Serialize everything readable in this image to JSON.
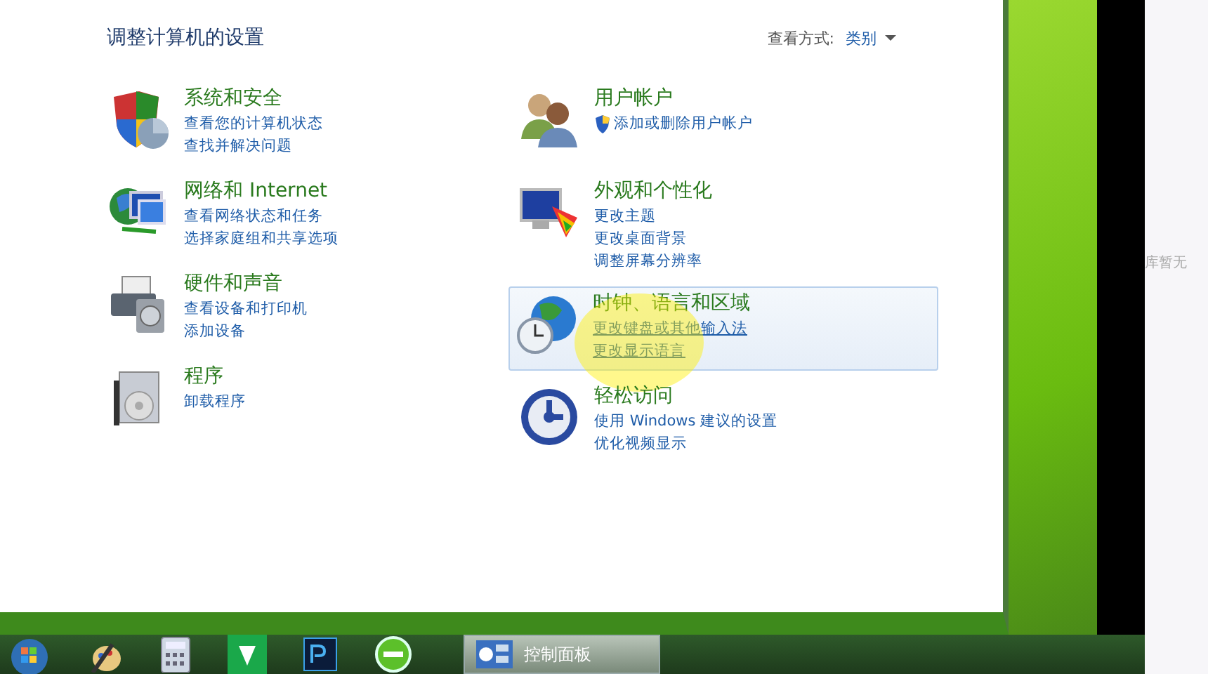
{
  "window": {
    "title": "调整计算机的设置",
    "view_by": {
      "label": "查看方式:",
      "value": "类别"
    }
  },
  "columns": [
    [
      {
        "kind": "security",
        "title": "系统和安全",
        "hovered": false,
        "links": [
          {
            "text": "查看您的计算机状态",
            "shield": false
          },
          {
            "text": "查找并解决问题",
            "shield": false
          }
        ]
      },
      {
        "kind": "network",
        "title": "网络和 Internet",
        "hovered": false,
        "links": [
          {
            "text": "查看网络状态和任务",
            "shield": false
          },
          {
            "text": "选择家庭组和共享选项",
            "shield": false
          }
        ]
      },
      {
        "kind": "hardware",
        "title": "硬件和声音",
        "hovered": false,
        "links": [
          {
            "text": "查看设备和打印机",
            "shield": false
          },
          {
            "text": "添加设备",
            "shield": false
          }
        ]
      },
      {
        "kind": "programs",
        "title": "程序",
        "hovered": false,
        "links": [
          {
            "text": "卸载程序",
            "shield": false
          }
        ]
      }
    ],
    [
      {
        "kind": "users",
        "title": "用户帐户",
        "hovered": false,
        "links": [
          {
            "text": "添加或删除用户帐户",
            "shield": true
          }
        ]
      },
      {
        "kind": "appearance",
        "title": "外观和个性化",
        "hovered": false,
        "links": [
          {
            "text": "更改主题",
            "shield": false
          },
          {
            "text": "更改桌面背景",
            "shield": false
          },
          {
            "text": "调整屏幕分辨率",
            "shield": false
          }
        ]
      },
      {
        "kind": "clock",
        "title": "时钟、语言和区域",
        "hovered": true,
        "links": [
          {
            "text": "更改键盘或其他输入法",
            "shield": false
          },
          {
            "text": "更改显示语言",
            "shield": false
          }
        ]
      },
      {
        "kind": "access",
        "title": "轻松访问",
        "hovered": false,
        "links": [
          {
            "text": "使用 Windows 建议的设置",
            "shield": false
          },
          {
            "text": "优化视频显示",
            "shield": false
          }
        ]
      }
    ]
  ],
  "taskbar": {
    "pinned": [
      {
        "kind": "start"
      },
      {
        "kind": "paint"
      },
      {
        "kind": "calculator"
      },
      {
        "kind": "green-app"
      },
      {
        "kind": "ps"
      },
      {
        "kind": "green-circle"
      }
    ],
    "tasks": [
      {
        "label": "控制面板",
        "active": true
      }
    ]
  },
  "side_panel": {
    "text": "库暂无"
  }
}
